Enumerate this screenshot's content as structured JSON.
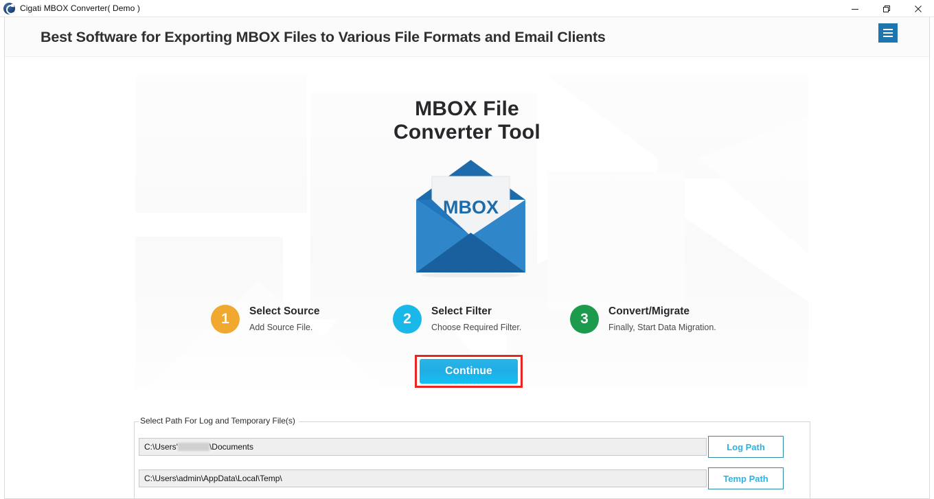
{
  "window": {
    "title": "Cigati MBOX Converter( Demo )",
    "app_icon": "cigati-logo-icon",
    "controls": {
      "minimize": "minimize-icon",
      "maximize": "restore-icon",
      "close": "close-icon"
    }
  },
  "banner": {
    "title": "Best Software for Exporting MBOX Files to Various File Formats and Email Clients",
    "menu_icon": "hamburger-menu-icon",
    "menu_color": "#1e76b0"
  },
  "hero": {
    "title_line1": "MBOX File",
    "title_line2": "Converter Tool",
    "envelope_label": "MBOX",
    "envelope_icon": "mbox-envelope-icon"
  },
  "steps": [
    {
      "number": "1",
      "title": "Select Source",
      "subtitle": "Add Source File.",
      "color": "#f0a830"
    },
    {
      "number": "2",
      "title": "Select Filter",
      "subtitle": "Choose Required Filter.",
      "color": "#1ab8e8"
    },
    {
      "number": "3",
      "title": "Convert/Migrate",
      "subtitle": "Finally, Start Data Migration.",
      "color": "#1b9b4b"
    }
  ],
  "continue": {
    "label": "Continue",
    "highlight_color": "#e8251f",
    "button_color": "#22ace4"
  },
  "path_group": {
    "legend": "Select Path For Log and Temporary File(s)",
    "rows": [
      {
        "value_prefix": "C:\\Users'",
        "value_suffix": "\\Documents",
        "redacted": true,
        "button_label": "Log Path",
        "button_name": "log-path-button"
      },
      {
        "value_prefix": "C:\\Users\\admin\\AppData\\Local\\Temp\\",
        "value_suffix": "",
        "redacted": false,
        "button_label": "Temp Path",
        "button_name": "temp-path-button"
      }
    ]
  }
}
